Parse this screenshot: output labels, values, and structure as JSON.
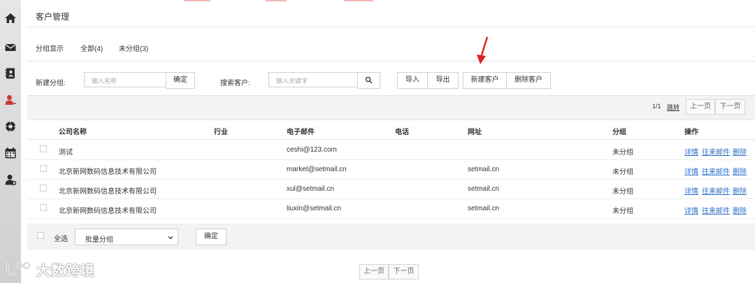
{
  "header": {
    "title": "客户管理"
  },
  "filters": [
    {
      "label": "分组显示"
    },
    {
      "label": "全部(4)"
    },
    {
      "label": "未分组(3)"
    }
  ],
  "toolbar": {
    "new_group_label": "新建分组:",
    "group_placeholder": "输入名称",
    "confirm_label": "确定",
    "search_label": "搜索客户:",
    "search_placeholder": "输入关键字",
    "import_label": "导入",
    "export_label": "导出",
    "new_customer_label": "新建客户",
    "delete_customer_label": "删除客户"
  },
  "pager": {
    "page_info": "1/1",
    "jump_label": "跳转",
    "prev_label": "上一页",
    "next_label": "下一页"
  },
  "table": {
    "headers": [
      "公司名称",
      "行业",
      "电子邮件",
      "电话",
      "网址",
      "分组",
      "操作"
    ],
    "rows": [
      {
        "company": "测试",
        "industry": "",
        "email": "ceshi@123.com",
        "phone": "",
        "website": "",
        "group": "未分组"
      },
      {
        "company": "北京新网数码信息技术有限公司",
        "industry": "",
        "email": "market@setmail.cn",
        "phone": "",
        "website": "setmail.cn",
        "group": "未分组"
      },
      {
        "company": "北京新网数码信息技术有限公司",
        "industry": "",
        "email": "xul@setmail.cn",
        "phone": "",
        "website": "setmail.cn",
        "group": "未分组"
      },
      {
        "company": "北京新网数码信息技术有限公司",
        "industry": "",
        "email": "liuxin@setmail.cn",
        "phone": "",
        "website": "setmail.cn",
        "group": "未分组"
      }
    ],
    "actions": {
      "detail": "详情",
      "mail": "往来邮件",
      "delete": "删除"
    }
  },
  "footer": {
    "select_all_label": "全选",
    "batch_group_value": "批量分组",
    "confirm_label": "确定",
    "prev_label": "上一页",
    "next_label": "下一页"
  },
  "watermark": {
    "text": "大数跨境"
  },
  "sidebar": {
    "icons": [
      "home-icon",
      "mail-icon",
      "contacts-icon",
      "customer-icon",
      "settings-icon",
      "calendar-icon",
      "user-admin-icon"
    ]
  },
  "colors": {
    "link": "#2a6fc9",
    "active_icon": "#c83a3a",
    "annotation_arrow": "#e02020"
  }
}
